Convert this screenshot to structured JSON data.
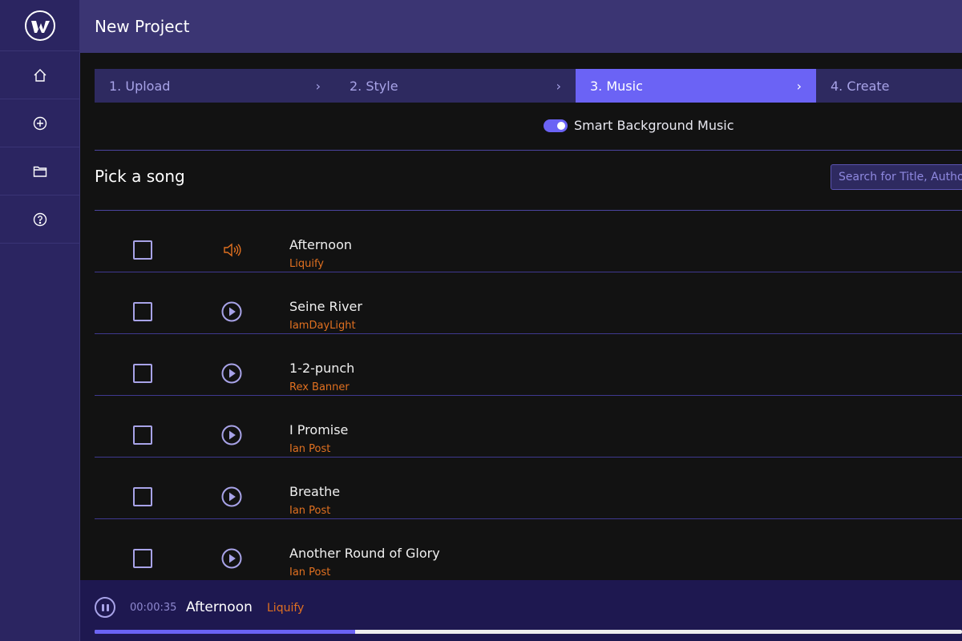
{
  "header": {
    "title": "New Project"
  },
  "sidebar": {
    "items": [
      {
        "icon": "home-icon"
      },
      {
        "icon": "plus-circle-icon"
      },
      {
        "icon": "folder-icon"
      },
      {
        "icon": "help-icon"
      }
    ]
  },
  "steps": [
    {
      "label": "1. Upload"
    },
    {
      "label": "2. Style"
    },
    {
      "label": "3. Music",
      "active": true
    },
    {
      "label": "4. Create"
    }
  ],
  "smart_music": {
    "label": "Smart Background Music",
    "enabled": true
  },
  "section_title": "Pick a song",
  "search": {
    "placeholder": "Search for Title, Author",
    "value": ""
  },
  "songs": [
    {
      "title": "Afternoon",
      "author": "Liquify",
      "playing": true,
      "checked": false
    },
    {
      "title": "Seine River",
      "author": "IamDayLight",
      "playing": false,
      "checked": false
    },
    {
      "title": "1-2-punch",
      "author": "Rex Banner",
      "playing": false,
      "checked": false
    },
    {
      "title": "I Promise",
      "author": "Ian Post",
      "playing": false,
      "checked": false
    },
    {
      "title": "Breathe",
      "author": "Ian Post",
      "playing": false,
      "checked": false
    },
    {
      "title": "Another Round of Glory",
      "author": "Ian Post",
      "playing": false,
      "checked": false
    }
  ],
  "player": {
    "time": "00:00:35",
    "title": "Afternoon",
    "author": "Liquify",
    "progress_percent": 30
  },
  "colors": {
    "accent": "#6b63f5",
    "author": "#e07020",
    "sidebar": "#2b2561",
    "header": "#3b3573",
    "player": "#1e1850"
  }
}
